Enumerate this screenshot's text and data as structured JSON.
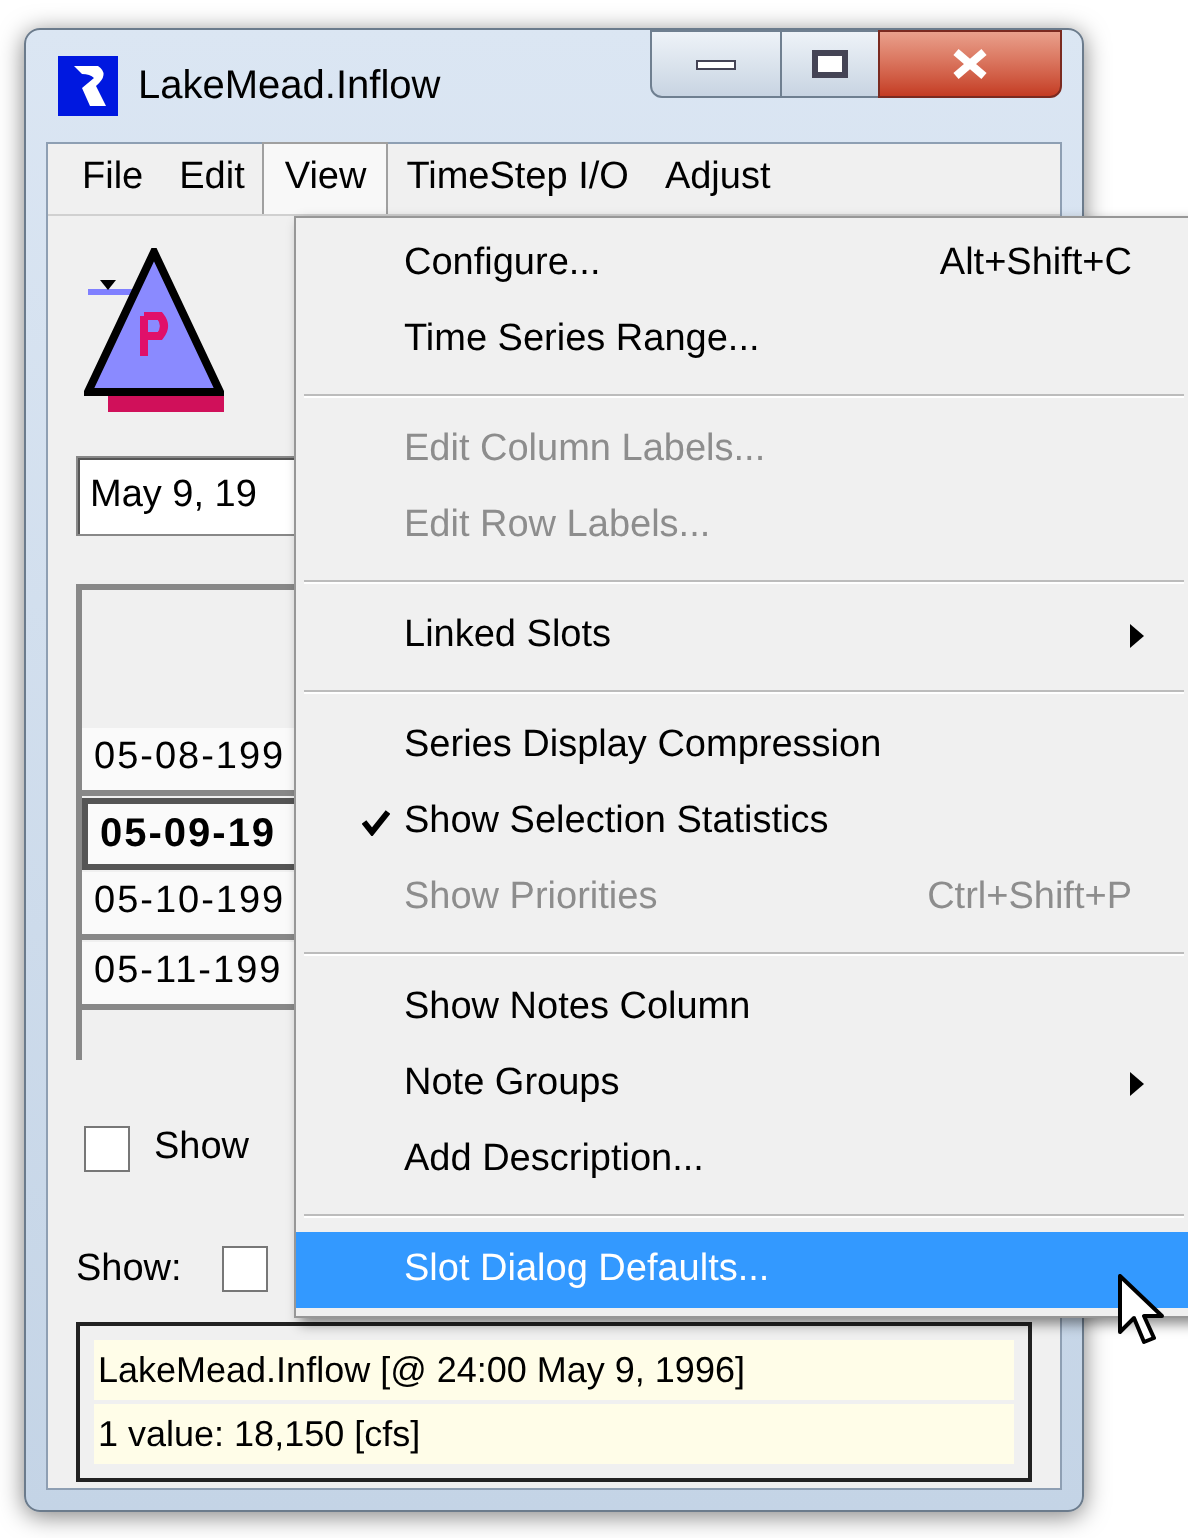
{
  "window": {
    "title": "LakeMead.Inflow"
  },
  "menubar": [
    {
      "label": "File",
      "selected": false
    },
    {
      "label": "Edit",
      "selected": false
    },
    {
      "label": "View",
      "selected": true
    },
    {
      "label": "TimeStep I/O",
      "selected": false
    },
    {
      "label": "Adjust",
      "selected": false
    }
  ],
  "date_field": {
    "value": "May 9, 19"
  },
  "table": {
    "rows": [
      {
        "label": "05-08-199",
        "selected": false
      },
      {
        "label": "05-09-19",
        "selected": true
      },
      {
        "label": "05-10-199",
        "selected": false
      },
      {
        "label": "05-11-199",
        "selected": false
      }
    ]
  },
  "show_checkbox": {
    "label": "Show",
    "checked": false
  },
  "show_row": {
    "label": "Show:",
    "checked": false
  },
  "status": {
    "line_1": "LakeMead.Inflow [@ 24:00 May 9, 1996]",
    "line_2": "1 value:  18,150 [cfs]"
  },
  "view_menu": [
    {
      "kind": "item",
      "label": "Configure...",
      "shortcut": "Alt+Shift+C",
      "disabled": false,
      "checked": false,
      "submenu": false,
      "selected": false
    },
    {
      "kind": "item",
      "label": "Time Series Range...",
      "disabled": false,
      "checked": false,
      "submenu": false,
      "selected": false
    },
    {
      "kind": "separator"
    },
    {
      "kind": "item",
      "label": "Edit Column Labels...",
      "disabled": true,
      "checked": false,
      "submenu": false,
      "selected": false
    },
    {
      "kind": "item",
      "label": "Edit Row Labels...",
      "disabled": true,
      "checked": false,
      "submenu": false,
      "selected": false
    },
    {
      "kind": "separator"
    },
    {
      "kind": "item",
      "label": "Linked Slots",
      "disabled": false,
      "checked": false,
      "submenu": true,
      "selected": false
    },
    {
      "kind": "separator"
    },
    {
      "kind": "item",
      "label": "Series Display Compression",
      "disabled": false,
      "checked": false,
      "submenu": false,
      "selected": false
    },
    {
      "kind": "item",
      "label": "Show Selection Statistics",
      "disabled": false,
      "checked": true,
      "submenu": false,
      "selected": false
    },
    {
      "kind": "item",
      "label": "Show Priorities",
      "shortcut": "Ctrl+Shift+P",
      "disabled": true,
      "checked": false,
      "submenu": false,
      "selected": false
    },
    {
      "kind": "separator"
    },
    {
      "kind": "item",
      "label": "Show Notes Column",
      "disabled": false,
      "checked": false,
      "submenu": false,
      "selected": false
    },
    {
      "kind": "item",
      "label": "Note Groups",
      "disabled": false,
      "checked": false,
      "submenu": true,
      "selected": false
    },
    {
      "kind": "item",
      "label": "Add Description...",
      "disabled": false,
      "checked": false,
      "submenu": false,
      "selected": false
    },
    {
      "kind": "separator"
    },
    {
      "kind": "item",
      "label": "Slot Dialog Defaults...",
      "disabled": false,
      "checked": false,
      "submenu": false,
      "selected": true
    }
  ]
}
